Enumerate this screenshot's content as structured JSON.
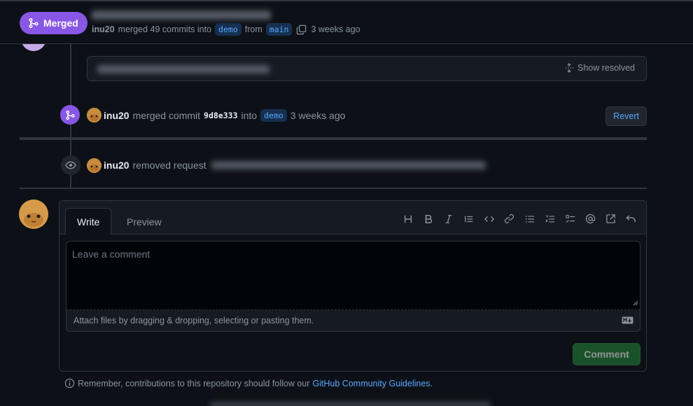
{
  "header": {
    "status": "Merged",
    "author": "inu20",
    "merged_text": "merged 49 commits into",
    "base_branch": "demo",
    "from_text": "from",
    "head_branch": "main",
    "time": "3 weeks ago",
    "status_color": "#8957e5"
  },
  "review_thread": {
    "show_resolved_label": "Show resolved"
  },
  "merge_event": {
    "author": "inu20",
    "action": "merged commit",
    "sha": "9d8e333",
    "into_text": "into",
    "branch": "demo",
    "time": "3 weeks ago",
    "revert_label": "Revert"
  },
  "removed_event": {
    "author": "inu20",
    "action": "removed request"
  },
  "comment_form": {
    "tabs": [
      "Write",
      "Preview"
    ],
    "placeholder": "Leave a comment",
    "attach_text": "Attach files by dragging & dropping, selecting or pasting them.",
    "submit_label": "Comment",
    "toolbar_icons": [
      "heading-icon",
      "bold-icon",
      "italic-icon",
      "quote-icon",
      "code-icon",
      "link-icon",
      "unordered-list-icon",
      "ordered-list-icon",
      "task-list-icon",
      "mention-icon",
      "cross-reference-icon",
      "undo-icon"
    ]
  },
  "footer": {
    "guideline_text": "Remember, contributions to this repository should follow our",
    "guideline_link": "GitHub Community Guidelines",
    "guideline_end": "."
  },
  "colors": {
    "background": "#0d1117",
    "accent_link": "#58a6ff",
    "merged_purple": "#8957e5",
    "button_green": "#238636"
  }
}
